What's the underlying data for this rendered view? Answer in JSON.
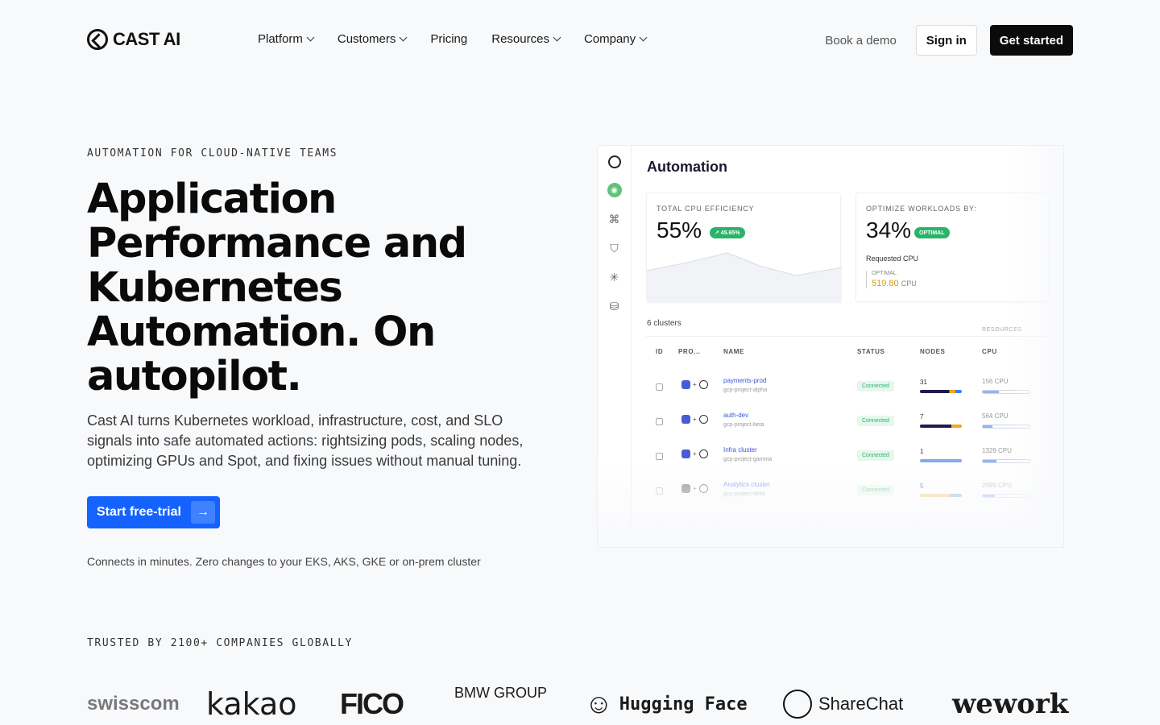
{
  "header": {
    "brand": "CAST AI",
    "nav": [
      {
        "label": "Platform",
        "dropdown": true
      },
      {
        "label": "Customers",
        "dropdown": true
      },
      {
        "label": "Pricing",
        "dropdown": false
      },
      {
        "label": "Resources",
        "dropdown": true
      },
      {
        "label": "Company",
        "dropdown": true
      }
    ],
    "book_demo": "Book a demo",
    "sign_in": "Sign in",
    "get_started": "Get started"
  },
  "hero": {
    "eyebrow": "AUTOMATION FOR CLOUD-NATIVE TEAMS",
    "title": "Application Performance and Kubernetes Automation. On autopilot.",
    "subtitle": "Cast AI turns Kubernetes workload, infrastructure, cost, and SLO signals into safe automated actions: rightsizing pods, scaling nodes, optimizing GPUs and Spot, and fixing issues without manual tuning.",
    "cta": "Start free-trial",
    "note": "Connects in minutes. Zero changes to your EKS, AKS, GKE or on-prem cluster"
  },
  "dashboard": {
    "title": "Automation",
    "cpu_card": {
      "label": "TOTAL CPU EFFICIENCY",
      "value": "55%",
      "badge": "↗ 45.65%"
    },
    "opt_card": {
      "label": "OPTIMIZE WORKLOADS BY:",
      "value": "34%",
      "badge": "OPTIMAL",
      "sub": "Requested CPU",
      "opt_label": "OPTIMAL",
      "opt_value": "519.80",
      "opt_unit": "CPU"
    },
    "clusters_label": "6 clusters",
    "resources_label": "RESOURCES",
    "columns": {
      "id": "ID",
      "provider": "PRO...",
      "name": "NAME",
      "status": "STATUS",
      "nodes": "NODES",
      "cpu": "CPU"
    },
    "rows": [
      {
        "name": "payments-prod",
        "project": "gcp-project-alpha",
        "status": "Connected",
        "nodes": "31",
        "cpu": "156 CPU",
        "cpu_pct": 0.35
      },
      {
        "name": "auth-dev",
        "project": "gcp-project-beta",
        "status": "Connected",
        "nodes": "7",
        "cpu": "564 CPU",
        "cpu_pct": 0.2
      },
      {
        "name": "Infra cluster",
        "project": "gcp-project-gamma",
        "status": "Connected",
        "nodes": "1",
        "cpu": "1329 CPU",
        "cpu_pct": 0.3
      },
      {
        "name": "Analytics cluster",
        "project": "gcp-project-delta",
        "status": "Connected",
        "nodes": "5",
        "cpu": "2999 CPU",
        "cpu_pct": 0.25
      }
    ]
  },
  "trusted": {
    "label": "TRUSTED BY 2100+ COMPANIES GLOBALLY",
    "logos": [
      "swisscom",
      "kakao",
      "FICO",
      "BMW GROUP",
      "Hugging Face",
      "ShareChat",
      "wework"
    ]
  }
}
